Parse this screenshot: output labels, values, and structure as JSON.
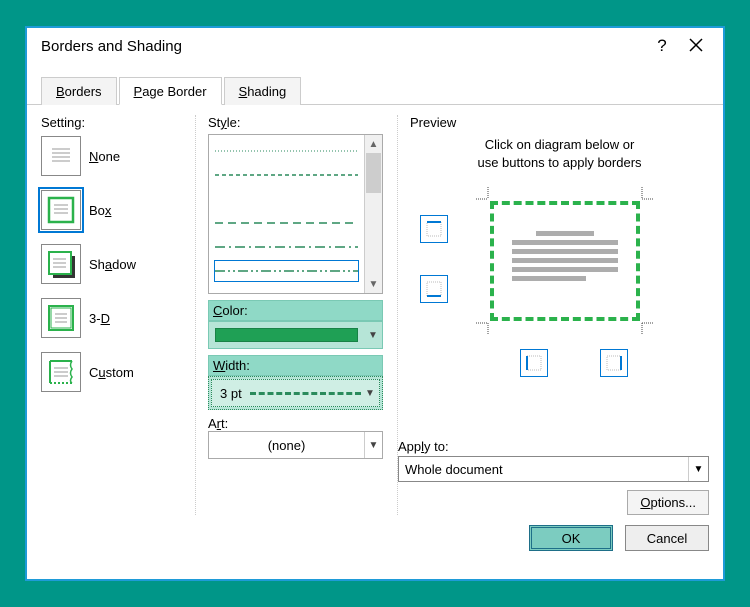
{
  "window": {
    "title": "Borders and Shading",
    "help": "?"
  },
  "tabs": {
    "borders": {
      "letter": "B",
      "rest": "orders"
    },
    "page_border": {
      "letter": "P",
      "rest": "age Border"
    },
    "shading": {
      "letter": "S",
      "rest": "hading"
    }
  },
  "setting": {
    "label": "Setting:",
    "none": {
      "pre": "",
      "u": "N",
      "post": "one"
    },
    "box": {
      "pre": "Bo",
      "u": "x",
      "post": ""
    },
    "shadow": {
      "pre": "Sh",
      "u": "a",
      "post": "dow"
    },
    "threeD": {
      "pre": "3-",
      "u": "D",
      "post": ""
    },
    "custom": {
      "pre": "C",
      "u": "u",
      "post": "stom"
    }
  },
  "style": {
    "label": {
      "pre": "St",
      "u": "y",
      "post": "le:"
    },
    "color_label": {
      "u": "C",
      "rest": "olor:"
    },
    "width_label": {
      "u": "W",
      "rest": "idth:"
    },
    "width_value": "3 pt",
    "art_label": {
      "pre": "A",
      "u": "r",
      "post": "t:"
    },
    "art_value": "(none)"
  },
  "preview": {
    "label": "Preview",
    "hint1": "Click on diagram below or",
    "hint2": "use buttons to apply borders",
    "apply_label": {
      "pre": "App",
      "u": "l",
      "post": "y to:"
    },
    "apply_value": "Whole document",
    "options": {
      "u": "O",
      "rest": "ptions..."
    }
  },
  "footer": {
    "ok": "OK",
    "cancel": "Cancel"
  }
}
